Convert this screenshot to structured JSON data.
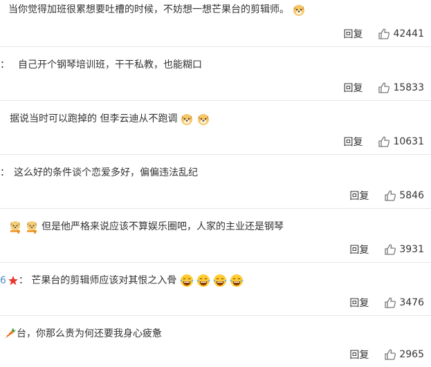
{
  "comments": [
    {
      "prefix": "",
      "text": "当你觉得加班很累想要吐槽的时候，不妨想一想芒果台的剪辑师。",
      "emojis": [
        "dog-face"
      ],
      "reply_label": "回复",
      "likes": "42441"
    },
    {
      "prefix": "：",
      "text": "自己开个钢琴培训班，干干私教，也能糊口",
      "emojis": [],
      "reply_label": "回复",
      "likes": "15833"
    },
    {
      "prefix": "",
      "text": "据说当时可以跑掉的 但李云迪从不跑调",
      "emojis": [
        "dog-face",
        "dog-face"
      ],
      "reply_label": "回复",
      "likes": "10631"
    },
    {
      "prefix": "：",
      "text": "这么好的条件谈个恋爱多好，偏偏违法乱纪",
      "emojis": [],
      "reply_label": "回复",
      "likes": "5846"
    },
    {
      "prefix": "",
      "text": "但是他严格来说应该不算娱乐圈吧，人家的主业还是钢琴",
      "emojis_before": [
        "doge-scarf",
        "doge-scarf"
      ],
      "reply_label": "回复",
      "likes": "3931"
    },
    {
      "prefix": "6",
      "text": "：  芒果台的剪辑师应该对其恨之入骨",
      "emojis": [
        "laugh-cry",
        "laugh-cry",
        "laugh-cry",
        "laugh-cry"
      ],
      "reply_label": "回复",
      "likes": "3476"
    },
    {
      "prefix": "",
      "text": "台，你那么贵为何还要我身心疲惫",
      "emojis_before": [
        "carrot"
      ],
      "reply_label": "回复",
      "likes": "2965"
    }
  ],
  "colors": {
    "link_blue": "#4a8ac9",
    "divider": "#e6e6e6",
    "text": "#333333"
  }
}
